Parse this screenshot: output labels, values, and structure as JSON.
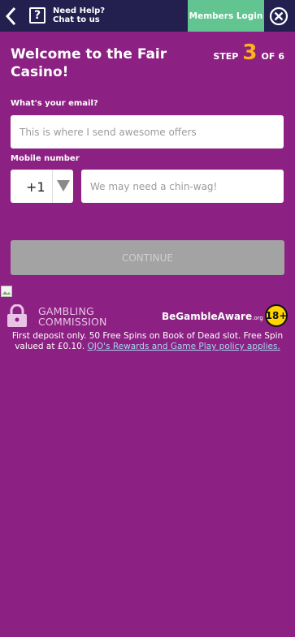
{
  "header": {
    "help_line1": "Need Help?",
    "help_line2": "Chat to us",
    "help_icon_glyph": "?",
    "members_login": "Members Login"
  },
  "title": "Welcome to the Fair Casino!",
  "step": {
    "prefix": "STEP",
    "current": "3",
    "separator": "OF",
    "total": "6"
  },
  "email": {
    "label": "What's your email?",
    "placeholder": "This is where I send awesome offers"
  },
  "mobile": {
    "label": "Mobile number",
    "country_code": "+1",
    "placeholder": "We may need a chin-wag!"
  },
  "continue_label": "CONTINUE",
  "footer": {
    "gambling_commission_line1": "GAMBLING",
    "gambling_commission_line2": "COMMISSION",
    "begambleaware_be": "BeGamble",
    "begambleaware_aware": "Aware",
    "begambleaware_org": ".org",
    "age_badge": "18+",
    "terms_text": "First deposit only. 50 Free Spins on Book of Dead slot. Free Spin valued at £0.10.",
    "terms_link": "OJO's Rewards and Game Play policy applies."
  },
  "colors": {
    "background": "#8c2183",
    "topbar": "#23204f",
    "members_button": "#62c490",
    "step_accent": "#ffb119",
    "continue_disabled": "#a3a3a3"
  }
}
